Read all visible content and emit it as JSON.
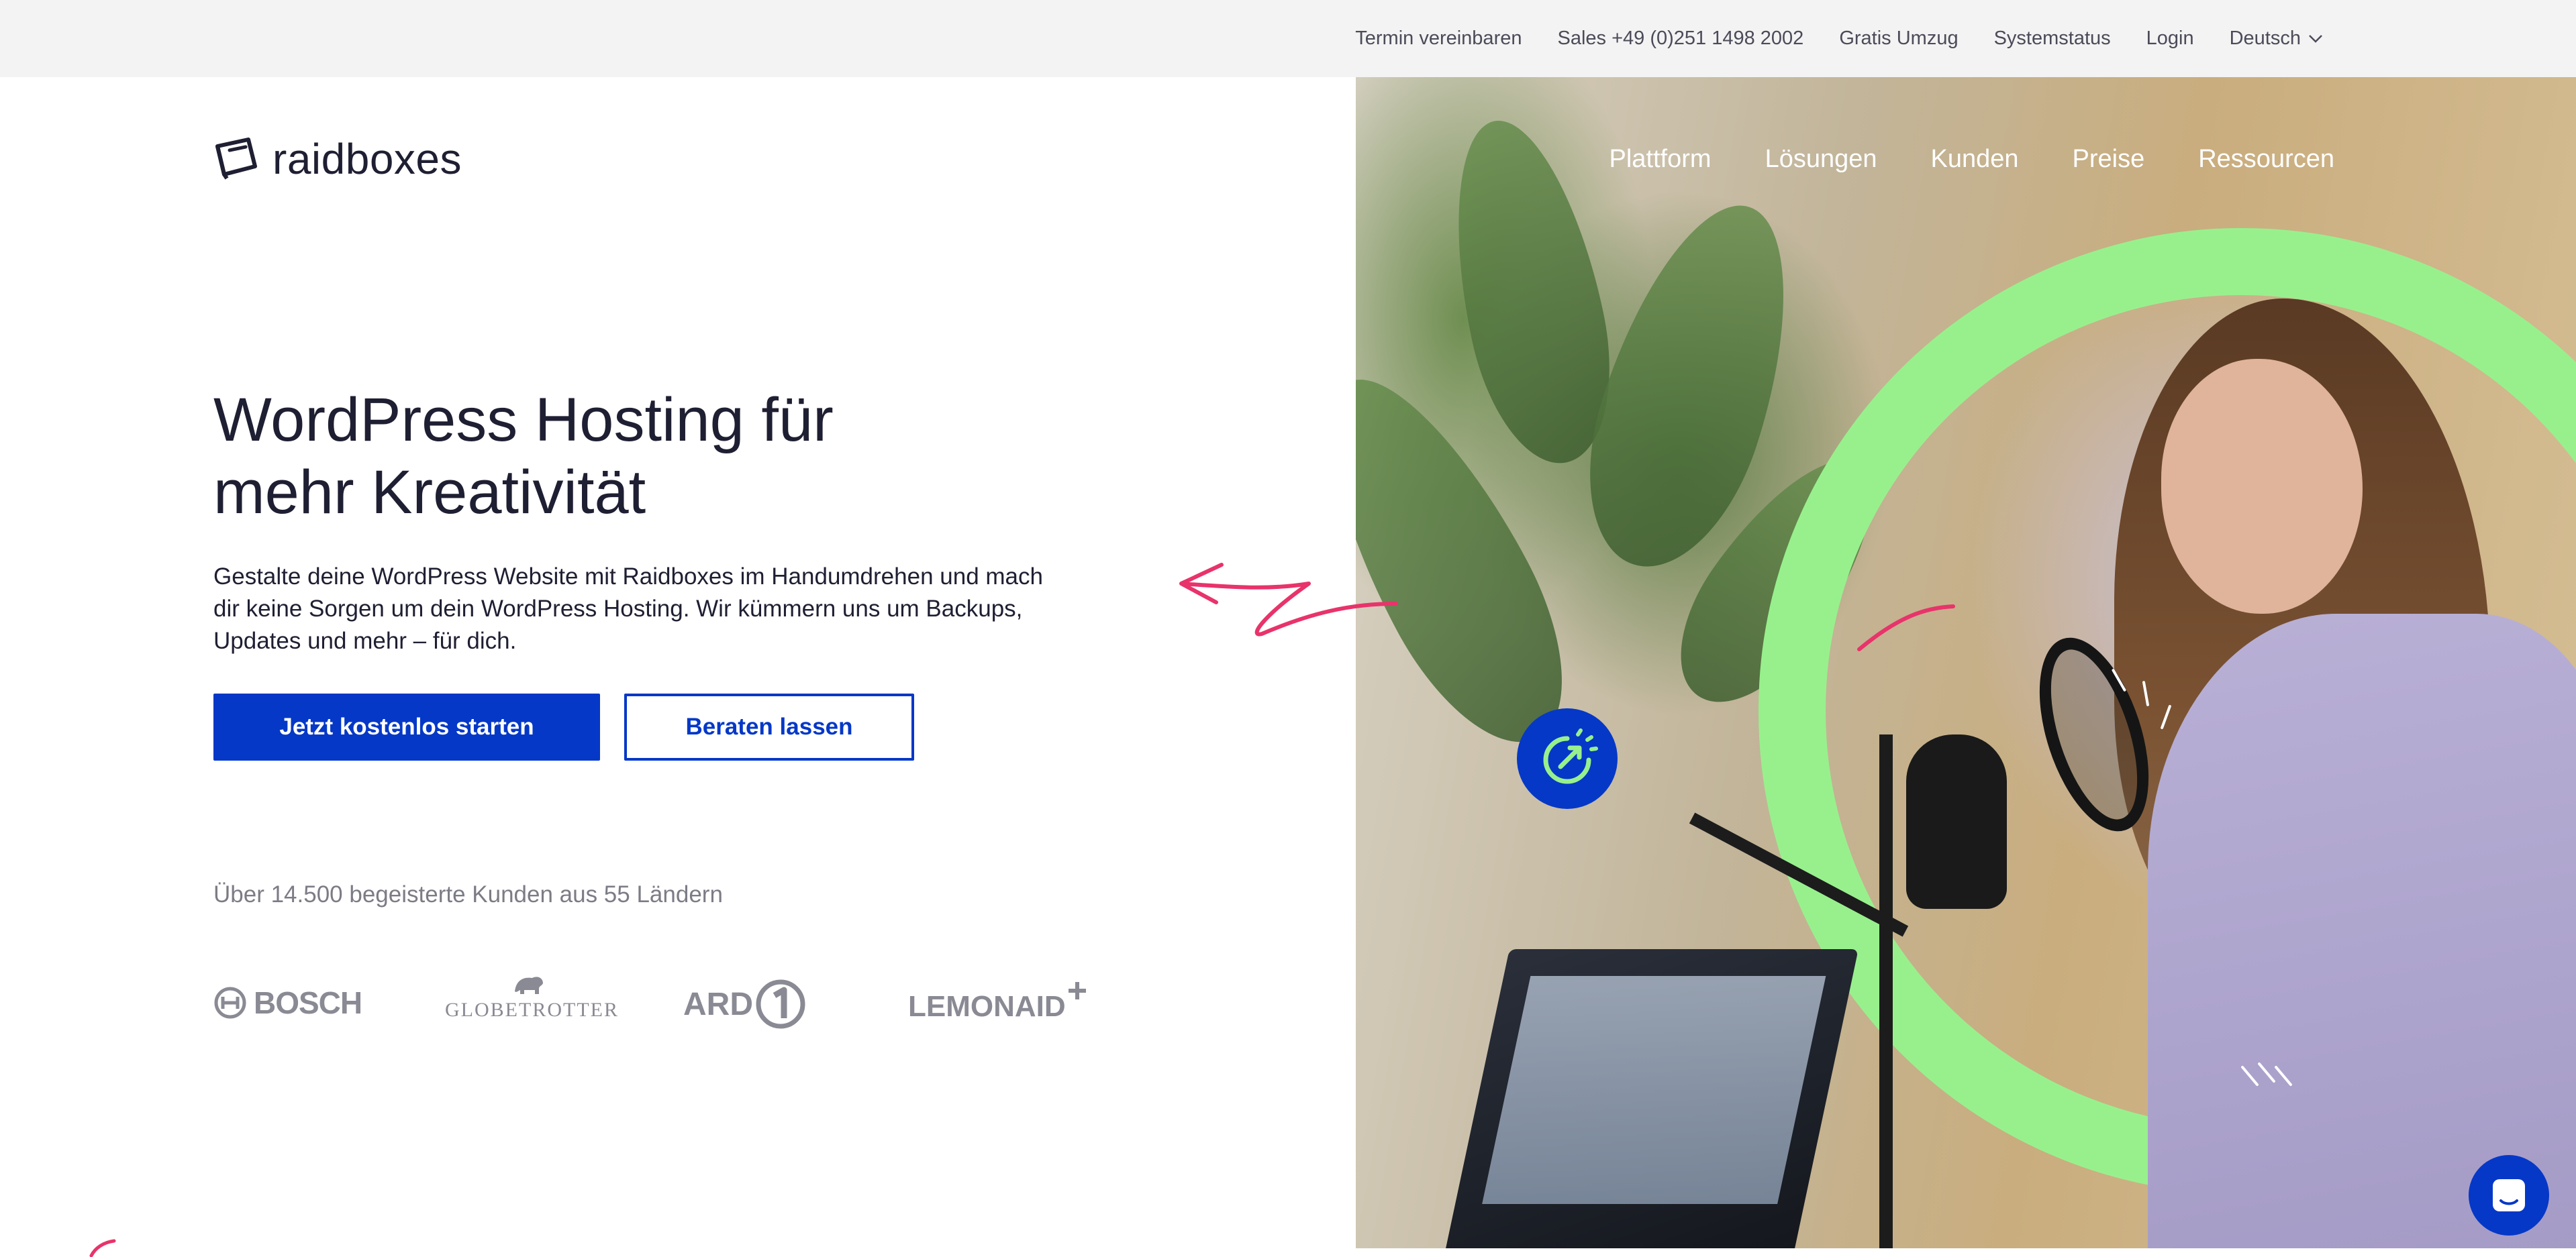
{
  "topbar": {
    "links": [
      {
        "label": "Termin vereinbaren"
      },
      {
        "label": "Sales +49 (0)251 1498 2002"
      },
      {
        "label": "Gratis Umzug"
      },
      {
        "label": "Systemstatus"
      },
      {
        "label": "Login"
      }
    ],
    "language": "Deutsch"
  },
  "header": {
    "logo_text": "raidboxes",
    "nav": [
      {
        "label": "Plattform"
      },
      {
        "label": "Lösungen"
      },
      {
        "label": "Kunden"
      },
      {
        "label": "Preise"
      },
      {
        "label": "Ressourcen"
      }
    ]
  },
  "hero": {
    "title_line1": "WordPress Hosting für",
    "title_line2": "mehr Kreativität",
    "description": "Gestalte deine WordPress Website mit Raidboxes im Handumdrehen und mach dir keine Sorgen um dein WordPress Hosting. Wir kümmern uns um Backups, Updates und mehr – für dich.",
    "primary_cta": "Jetzt kostenlos starten",
    "secondary_cta": "Beraten lassen"
  },
  "customers": {
    "headline": "Über 14.500 begeisterte Kunden aus 55 Ländern",
    "logos": [
      {
        "name": "BOSCH"
      },
      {
        "name": "GLOBETROTTER"
      },
      {
        "name": "ARD"
      },
      {
        "name": "LEMONAID"
      }
    ]
  },
  "colors": {
    "brand_blue": "#0538c7",
    "ring_green": "#98f08d",
    "accent_pink": "#e8336b",
    "topbar_bg": "#f3f3f3"
  },
  "icons": [
    "raidboxes-logo-icon",
    "chevron-down-icon",
    "chat-icon",
    "speed-gauge-icon",
    "bosch-logo-icon",
    "bear-icon",
    "ard-one-icon",
    "plus-icon"
  ]
}
